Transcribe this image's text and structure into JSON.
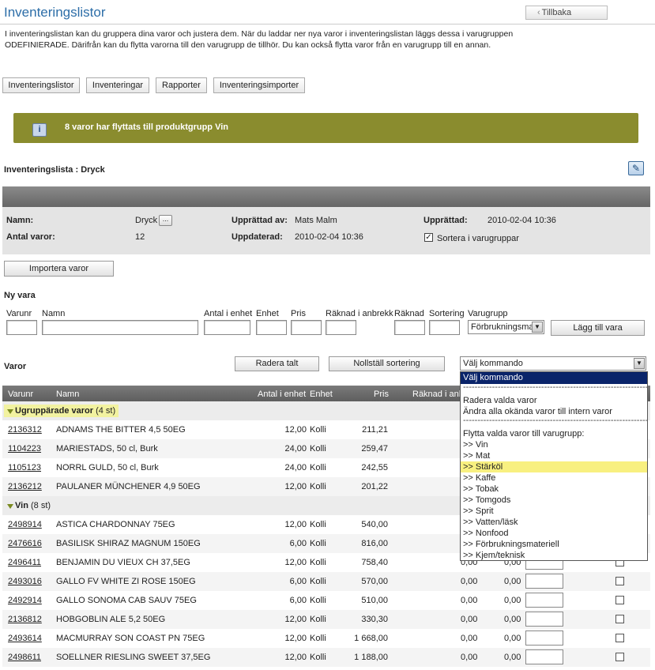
{
  "page": {
    "title": "Inventeringslistor",
    "back_label": "Tillbaka",
    "intro": "I inventeringslistan kan du gruppera dina varor och justera dem. När du laddar ner nya varor i inventeringslistan läggs dessa i varugruppen ODEFINIERADE. Därifrån kan du flytta varorna till den varugrupp de tillhör. Du kan också flytta varor från en varugrupp till en annan."
  },
  "tabs": [
    "Inventeringslistor",
    "Inventeringar",
    "Rapporter",
    "Inventeringsimporter"
  ],
  "banner": {
    "icon": "info-icon",
    "message": "8 varor har flyttats till produktgrupp Vin",
    "color": "#8a8c2e"
  },
  "list": {
    "heading": "Inventeringslista : Dryck",
    "name_label": "Namn:",
    "name_value": "Dryck",
    "name_btn": "...",
    "count_label": "Antal varor:",
    "count_value": "12",
    "created_by_label": "Upprättad av:",
    "created_by_value": "Mats Malm",
    "updated_label": "Uppdaterad:",
    "updated_value": "2010-02-04 10:36",
    "created_label": "Upprättad:",
    "created_value": "2010-02-04 10:36",
    "sort_label": "Sortera i varugruppar",
    "sort_checked": true
  },
  "import_btn": "Importera varor",
  "new_item": {
    "title": "Ny vara",
    "cols": [
      "Varunr",
      "Namn",
      "Antal i enhet",
      "Enhet",
      "Pris",
      "Räknad i anbrekk",
      "Räknad",
      "Sortering",
      "Varugrupp"
    ],
    "group_value": "Förbrukningsma",
    "add_btn": "Lägg till vara"
  },
  "varor": {
    "title": "Varor",
    "delete_btn": "Radera talt",
    "reset_btn": "Nollställ sortering",
    "command_value": "Välj kommando"
  },
  "table": {
    "headers": [
      "Varunr",
      "Namn",
      "Antal i enhet",
      "Enhet",
      "Pris",
      "Räknad i anb"
    ],
    "groups": [
      {
        "label": "Ugruppärade varor",
        "count": "(4 st)",
        "highlight": true,
        "rows": [
          {
            "nr": "2136312",
            "name": "ADNAMS THE BITTER 4,5 50EG",
            "qty": "12,00",
            "unit": "Kolli",
            "price": "211,21"
          },
          {
            "nr": "1104223",
            "name": "MARIESTADS, 50 cl, Burk",
            "qty": "24,00",
            "unit": "Kolli",
            "price": "259,47"
          },
          {
            "nr": "1105123",
            "name": "NORRL GULD, 50 cl, Burk",
            "qty": "24,00",
            "unit": "Kolli",
            "price": "242,55"
          },
          {
            "nr": "2136212",
            "name": "PAULANER MÜNCHENER 4,9 50EG",
            "qty": "12,00",
            "unit": "Kolli",
            "price": "201,22"
          }
        ]
      },
      {
        "label": "Vin",
        "count": "(8 st)",
        "highlight": false,
        "rows": [
          {
            "nr": "2498914",
            "name": "ASTICA CHARDONNAY 75EG",
            "qty": "12,00",
            "unit": "Kolli",
            "price": "540,00"
          },
          {
            "nr": "2476616",
            "name": "BASILISK SHIRAZ MAGNUM 150EG",
            "qty": "6,00",
            "unit": "Kolli",
            "price": "816,00"
          },
          {
            "nr": "2496411",
            "name": "BENJAMIN DU VIEUX CH 37,5EG",
            "qty": "12,00",
            "unit": "Kolli",
            "price": "758,40",
            "c1": "0,00",
            "c2": "0,00"
          },
          {
            "nr": "2493016",
            "name": "GALLO FV WHITE ZI ROSE 150EG",
            "qty": "6,00",
            "unit": "Kolli",
            "price": "570,00",
            "c1": "0,00",
            "c2": "0,00"
          },
          {
            "nr": "2492914",
            "name": "GALLO SONOMA CAB SAUV 75EG",
            "qty": "6,00",
            "unit": "Kolli",
            "price": "510,00",
            "c1": "0,00",
            "c2": "0,00"
          },
          {
            "nr": "2136812",
            "name": "HOBGOBLIN ALE 5,2 50EG",
            "qty": "12,00",
            "unit": "Kolli",
            "price": "330,30",
            "c1": "0,00",
            "c2": "0,00"
          },
          {
            "nr": "2493614",
            "name": "MACMURRAY SON COAST PN 75EG",
            "qty": "12,00",
            "unit": "Kolli",
            "price": "1 668,00",
            "c1": "0,00",
            "c2": "0,00"
          },
          {
            "nr": "2498611",
            "name": "SOELLNER RIESLING SWEET 37,5EG",
            "qty": "12,00",
            "unit": "Kolli",
            "price": "1 188,00",
            "c1": "0,00",
            "c2": "0,00"
          }
        ]
      }
    ]
  },
  "dropdown": {
    "items": [
      {
        "label": "Välj kommando",
        "type": "first"
      },
      {
        "label": "------------------------------------------------------------------",
        "type": "sep"
      },
      {
        "label": "Radera valda varor",
        "type": "item"
      },
      {
        "label": "Ändra alla okända varor till intern varor",
        "type": "item"
      },
      {
        "label": "------------------------------------------------------------------",
        "type": "sep"
      },
      {
        "label": "Flytta valda varor till varugrupp:",
        "type": "item"
      },
      {
        "label": ">> Vin",
        "type": "item"
      },
      {
        "label": ">> Mat",
        "type": "item"
      },
      {
        "label": ">> Stärköl",
        "type": "selected"
      },
      {
        "label": ">> Kaffe",
        "type": "item"
      },
      {
        "label": ">> Tobak",
        "type": "item"
      },
      {
        "label": ">> Tomgods",
        "type": "item"
      },
      {
        "label": ">> Sprit",
        "type": "item"
      },
      {
        "label": ">> Vatten/läsk",
        "type": "item"
      },
      {
        "label": ">> Nonfood",
        "type": "item"
      },
      {
        "label": ">> Förbrukningsmateriell",
        "type": "item"
      },
      {
        "label": ">> Kjem/teknisk",
        "type": "item"
      }
    ]
  }
}
